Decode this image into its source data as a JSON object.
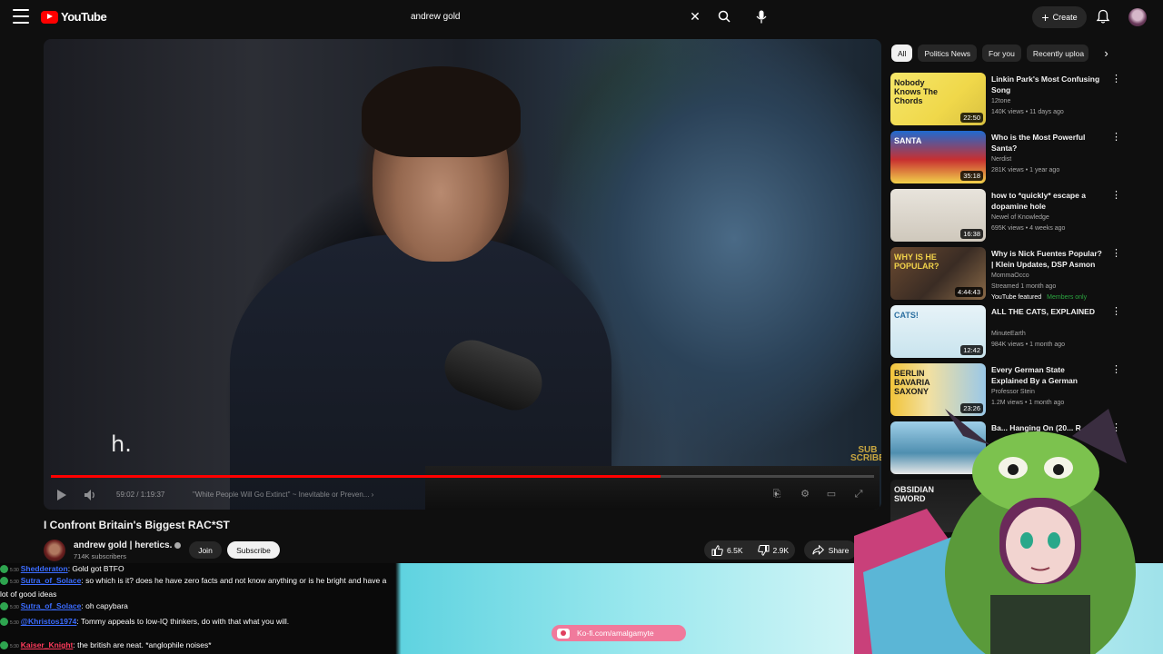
{
  "header": {
    "logo_text": "YouTube",
    "search_value": "andrew gold",
    "create_label": "Create"
  },
  "player": {
    "subtitle_text": "h.",
    "overlay_logo": "SUB SCRIBE",
    "time": "59:02 / 1:19:37",
    "chapter": "\"White People Will Go Extinct\" ~ Inevitable or Preven... ›",
    "progress_fraction": 0.741
  },
  "video": {
    "title": "I Confront Britain's Biggest RAC*ST",
    "channel_name": "andrew gold | heretics.",
    "subscribers": "714K subscribers",
    "join_label": "Join",
    "subscribe_label": "Subscribe",
    "likes": "6.5K",
    "dislikes": "2.9K",
    "share_label": "Share"
  },
  "chips": [
    {
      "label": "All",
      "active": true
    },
    {
      "label": "Politics News",
      "active": false
    },
    {
      "label": "For you",
      "active": false
    },
    {
      "label": "Recently uploa",
      "active": false
    }
  ],
  "recommendations": [
    {
      "title": "Linkin Park's Most Confusing Song",
      "channel": "12tone",
      "meta": "140K views • 11 days ago",
      "duration": "22:50",
      "thumb_text": "Nobody Knows The Chords"
    },
    {
      "title": "Who is the Most Powerful Santa?",
      "channel": "Nerdist",
      "meta": "281K views • 1 year ago",
      "duration": "35:18",
      "thumb_text": "SANTA"
    },
    {
      "title": "how to *quickly* escape a dopamine hole",
      "channel": "Newel of Knowledge",
      "meta": "695K views • 4 weeks ago",
      "duration": "16:38",
      "thumb_text": ""
    },
    {
      "title": "Why is Nick Fuentes Popular? | Klein Updates, DSP Asmon ...",
      "channel": "MommaOcco",
      "meta": "Streamed 1 month ago",
      "duration": "4:44:43",
      "thumb_text": "WHY IS HE POPULAR?",
      "badge": "YouTube featured",
      "badge2": "Members only"
    },
    {
      "title": "ALL THE CATS, EXPLAINED",
      "channel": "MinuteEarth",
      "meta": "984K views • 1 month ago",
      "duration": "12:42",
      "thumb_text": "CATS!"
    },
    {
      "title": "Every German State Explained By a German",
      "channel": "Professor Stein",
      "meta": "1.2M views • 1 month ago",
      "duration": "23:26",
      "thumb_text": "BERLIN BAVARIA SAXONY"
    },
    {
      "title": "Ba... Hanging On (20... R...",
      "channel": "",
      "meta": "",
      "duration": "",
      "thumb_text": ""
    },
    {
      "title": "",
      "channel": "",
      "meta": "",
      "duration": "",
      "thumb_text": "OBSIDIAN SWORD"
    }
  ],
  "chat": [
    {
      "ts": "5:30",
      "user": "Shedderaton",
      "msg": "Gold got BTFO",
      "color": "#3b6cff"
    },
    {
      "ts": "5:30",
      "user": "Sutra_of_Solace",
      "msg": "so which is it? does he have zero facts and not know anything or is he bright and have a lot of good ideas",
      "color": "#3b6cff"
    },
    {
      "ts": "5:30",
      "user": "Sutra_of_Solace",
      "msg": "oh capybara",
      "color": "#3b6cff"
    },
    {
      "ts": "5:30",
      "user": "@Khristos1974",
      "msg": "Tommy appeals to low-IQ thinkers, do with that what you will.",
      "color": "#3b6cff"
    },
    {
      "ts": "5:30",
      "user": "Kaiser_Knight",
      "msg": "the british are neat. *anglophile noises*",
      "color": "#ff3b5c"
    }
  ],
  "kofi_label": "Ko-fi.com/amalgamyte",
  "colors": {
    "accent": "#ff0000",
    "background": "#0f0f0f",
    "chip_bg": "#272727",
    "members": "#2ba640",
    "kofi": "#f07a9c"
  }
}
